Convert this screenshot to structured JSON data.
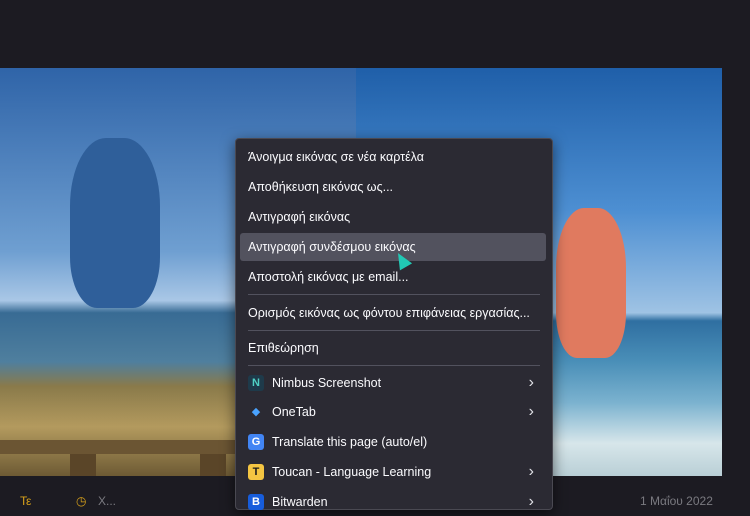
{
  "context_menu": {
    "items": [
      {
        "label": "Άνοιγμα εικόνας σε νέα καρτέλα"
      },
      {
        "label": "Αποθήκευση εικόνας ως..."
      },
      {
        "label": "Αντιγραφή εικόνας"
      },
      {
        "label": "Αντιγραφή συνδέσμου εικόνας"
      },
      {
        "label": "Αποστολή εικόνας με email..."
      },
      {
        "label": "Ορισμός εικόνας ως φόντου επιφάνειας εργασίας..."
      },
      {
        "label": "Επιθεώρηση"
      },
      {
        "label": "Nimbus Screenshot",
        "icon": "nimbus-icon",
        "icon_text": "N"
      },
      {
        "label": "OneTab",
        "icon": "onetab-icon",
        "icon_text": "◆"
      },
      {
        "label": "Translate this page (auto/el)",
        "icon": "translate-icon",
        "icon_text": "G"
      },
      {
        "label": "Toucan - Language Learning",
        "icon": "toucan-icon",
        "icon_text": "T"
      },
      {
        "label": "Bitwarden",
        "icon": "bitwarden-icon",
        "icon_text": "B"
      }
    ]
  },
  "bottom_bar": {
    "left_text": "Τε",
    "middle_text": "Χ...",
    "right_text": "1 Μαΐου 2022"
  },
  "colors": {
    "menu_bg": "#2b2a33",
    "menu_hover": "#52525e",
    "accent": "#d9a21a"
  }
}
